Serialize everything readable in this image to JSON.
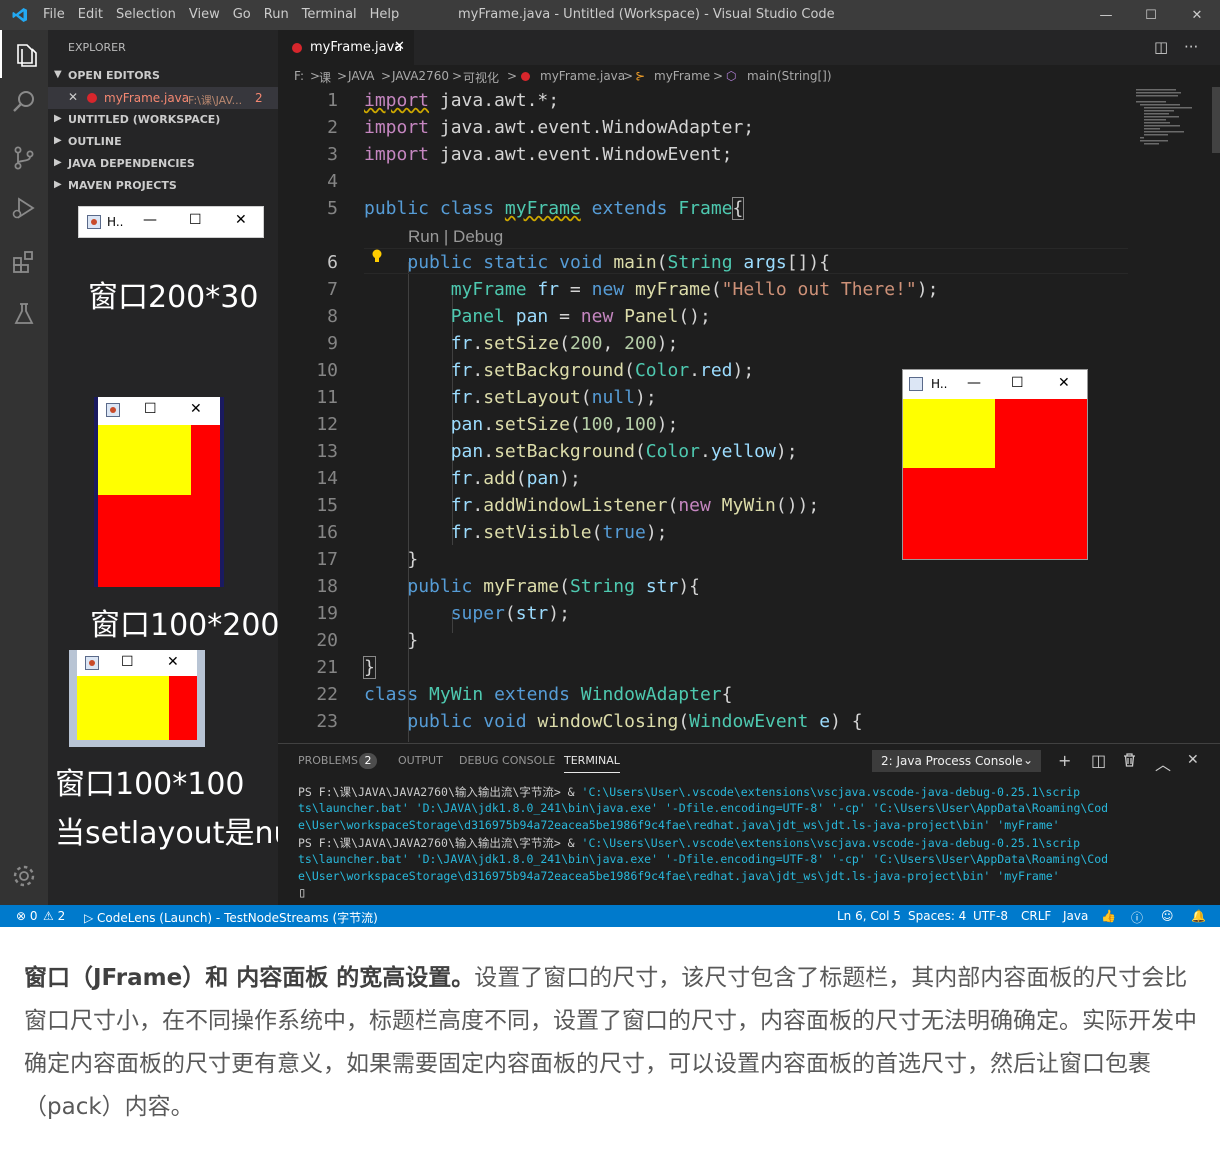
{
  "window": {
    "title": "myFrame.java - Untitled (Workspace) - Visual Studio Code",
    "menu": [
      "File",
      "Edit",
      "Selection",
      "View",
      "Go",
      "Run",
      "Terminal",
      "Help"
    ],
    "controls": {
      "minimize": "—",
      "maximize": "☐",
      "close": "✕"
    }
  },
  "activity_bar": [
    "files-icon",
    "search-icon",
    "source-control-icon",
    "run-debug-icon",
    "extensions-icon",
    "testing-icon",
    "settings-gear-icon"
  ],
  "sidebar": {
    "title": "EXPLORER",
    "open_editors": {
      "label": "OPEN EDITORS",
      "file": {
        "close": "✕",
        "name": "myFrame.java",
        "path": "F:\\课\\JAV...",
        "problems": "2"
      }
    },
    "sections": [
      "UNTITLED (WORKSPACE)",
      "OUTLINE",
      "JAVA DEPENDENCIES",
      "MAVEN PROJECTS"
    ]
  },
  "snippets": {
    "win1": {
      "title": "H..",
      "caption": "窗口200*30"
    },
    "win2": {
      "caption": "窗口100*200"
    },
    "win3": {
      "caption_line1": "窗口100*100",
      "caption_line2": "当setlayout是null"
    }
  },
  "tab": {
    "name": "myFrame.java",
    "close": "✕"
  },
  "tab_actions": {
    "split": "◫",
    "more": "···"
  },
  "breadcrumb": {
    "drive": "F:",
    "parts": [
      "课",
      "JAVA",
      "JAVA2760",
      "可视化",
      "myFrame.java",
      "myFrame",
      "main(String[])"
    ],
    "sep": ">"
  },
  "editor": {
    "codelens": "Run | Debug",
    "line_numbers": [
      "1",
      "2",
      "3",
      "4",
      "5",
      "6",
      "7",
      "8",
      "9",
      "10",
      "11",
      "12",
      "13",
      "14",
      "15",
      "16",
      "17",
      "18",
      "19",
      "20",
      "21",
      "22",
      "23"
    ]
  },
  "running_window": {
    "title": "H.."
  },
  "panel": {
    "tabs": {
      "problems": "PROBLEMS",
      "problems_count": "2",
      "output": "OUTPUT",
      "debug": "DEBUG CONSOLE",
      "terminal": "TERMINAL"
    },
    "terminal_select": "2: Java Process Console",
    "icons": {
      "add": "+",
      "split": "◫",
      "trash": "🗑",
      "maximize": "︿",
      "close": "✕"
    },
    "terminal_lines": {
      "p1a": "PS F:\\课\\JAVA\\JAVA2760\\输入输出流\\字节流> ",
      "p1b": "& ",
      "p1c": "'C:\\Users\\User\\.vscode\\extensions\\vscjava.vscode-java-debug-0.25.1\\scrip",
      "l2": "ts\\launcher.bat' 'D:\\JAVA\\jdk1.8.0_241\\bin\\java.exe' '-Dfile.encoding=UTF-8' '-cp' 'C:\\Users\\User\\AppData\\Roaming\\Cod",
      "l3": "e\\User\\workspaceStorage\\d316975b94a72eacea5be1986f9c4fae\\redhat.java\\jdt_ws\\jdt.ls-java-project\\bin' 'myFrame'",
      "p4a": "PS F:\\课\\JAVA\\JAVA2760\\输入输出流\\字节流> ",
      "p4b": "& ",
      "p4c": "'C:\\Users\\User\\.vscode\\extensions\\vscjava.vscode-java-debug-0.25.1\\scrip",
      "l5": "ts\\launcher.bat' 'D:\\JAVA\\jdk1.8.0_241\\bin\\java.exe' '-Dfile.encoding=UTF-8' '-cp' 'C:\\Users\\User\\AppData\\Roaming\\Cod",
      "l6": "e\\User\\workspaceStorage\\d316975b94a72eacea5be1986f9c4fae\\redhat.java\\jdt_ws\\jdt.ls-java-project\\bin' 'myFrame'",
      "cursor": "▯"
    }
  },
  "statusbar": {
    "errors": "⊗ 0",
    "warnings": "⚠ 2",
    "launch": "▷ CodeLens (Launch) - TestNodeStreams (字节流)",
    "position": "Ln 6, Col 5",
    "spaces": "Spaces: 4",
    "encoding": "UTF-8",
    "eol": "CRLF",
    "language": "Java"
  },
  "description": {
    "bold": "窗口（JFrame）和 内容面板 的宽高设置。",
    "text": "设置了窗口的尺寸，该尺寸包含了标题栏，其内部内容面板的尺寸会比窗口尺寸小，在不同操作系统中，标题栏高度不同，设置了窗口的尺寸，内容面板的尺寸无法明确确定。实际开发中确定内容面板的尺寸更有意义，如果需要固定内容面板的尺寸，可以设置内容面板的首选尺寸，然后让窗口包裹（pack）内容。"
  },
  "colors": {
    "accent": "#007acc",
    "frame_bg": "#ff0000",
    "panel_bg": "#ffff00"
  }
}
